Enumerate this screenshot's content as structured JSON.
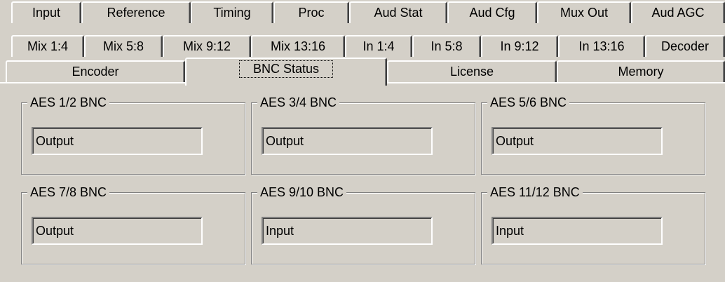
{
  "tabs": {
    "row1": [
      "Input",
      "Reference",
      "Timing",
      "Proc",
      "Aud Stat",
      "Aud Cfg",
      "Mux Out",
      "Aud AGC"
    ],
    "row2": [
      "Mix 1:4",
      "Mix 5:8",
      "Mix 9:12",
      "Mix 13:16",
      "In 1:4",
      "In 5:8",
      "In 9:12",
      "In 13:16",
      "Decoder"
    ],
    "row3": [
      "Encoder",
      "BNC Status",
      "License",
      "Memory"
    ],
    "active": "BNC Status"
  },
  "groups": [
    {
      "title": "AES 1/2 BNC",
      "value": "Output"
    },
    {
      "title": "AES 3/4 BNC",
      "value": "Output"
    },
    {
      "title": "AES 5/6 BNC",
      "value": "Output"
    },
    {
      "title": "AES 7/8 BNC",
      "value": "Output"
    },
    {
      "title": "AES 9/10 BNC",
      "value": "Input"
    },
    {
      "title": "AES 11/12 BNC",
      "value": "Input"
    }
  ]
}
